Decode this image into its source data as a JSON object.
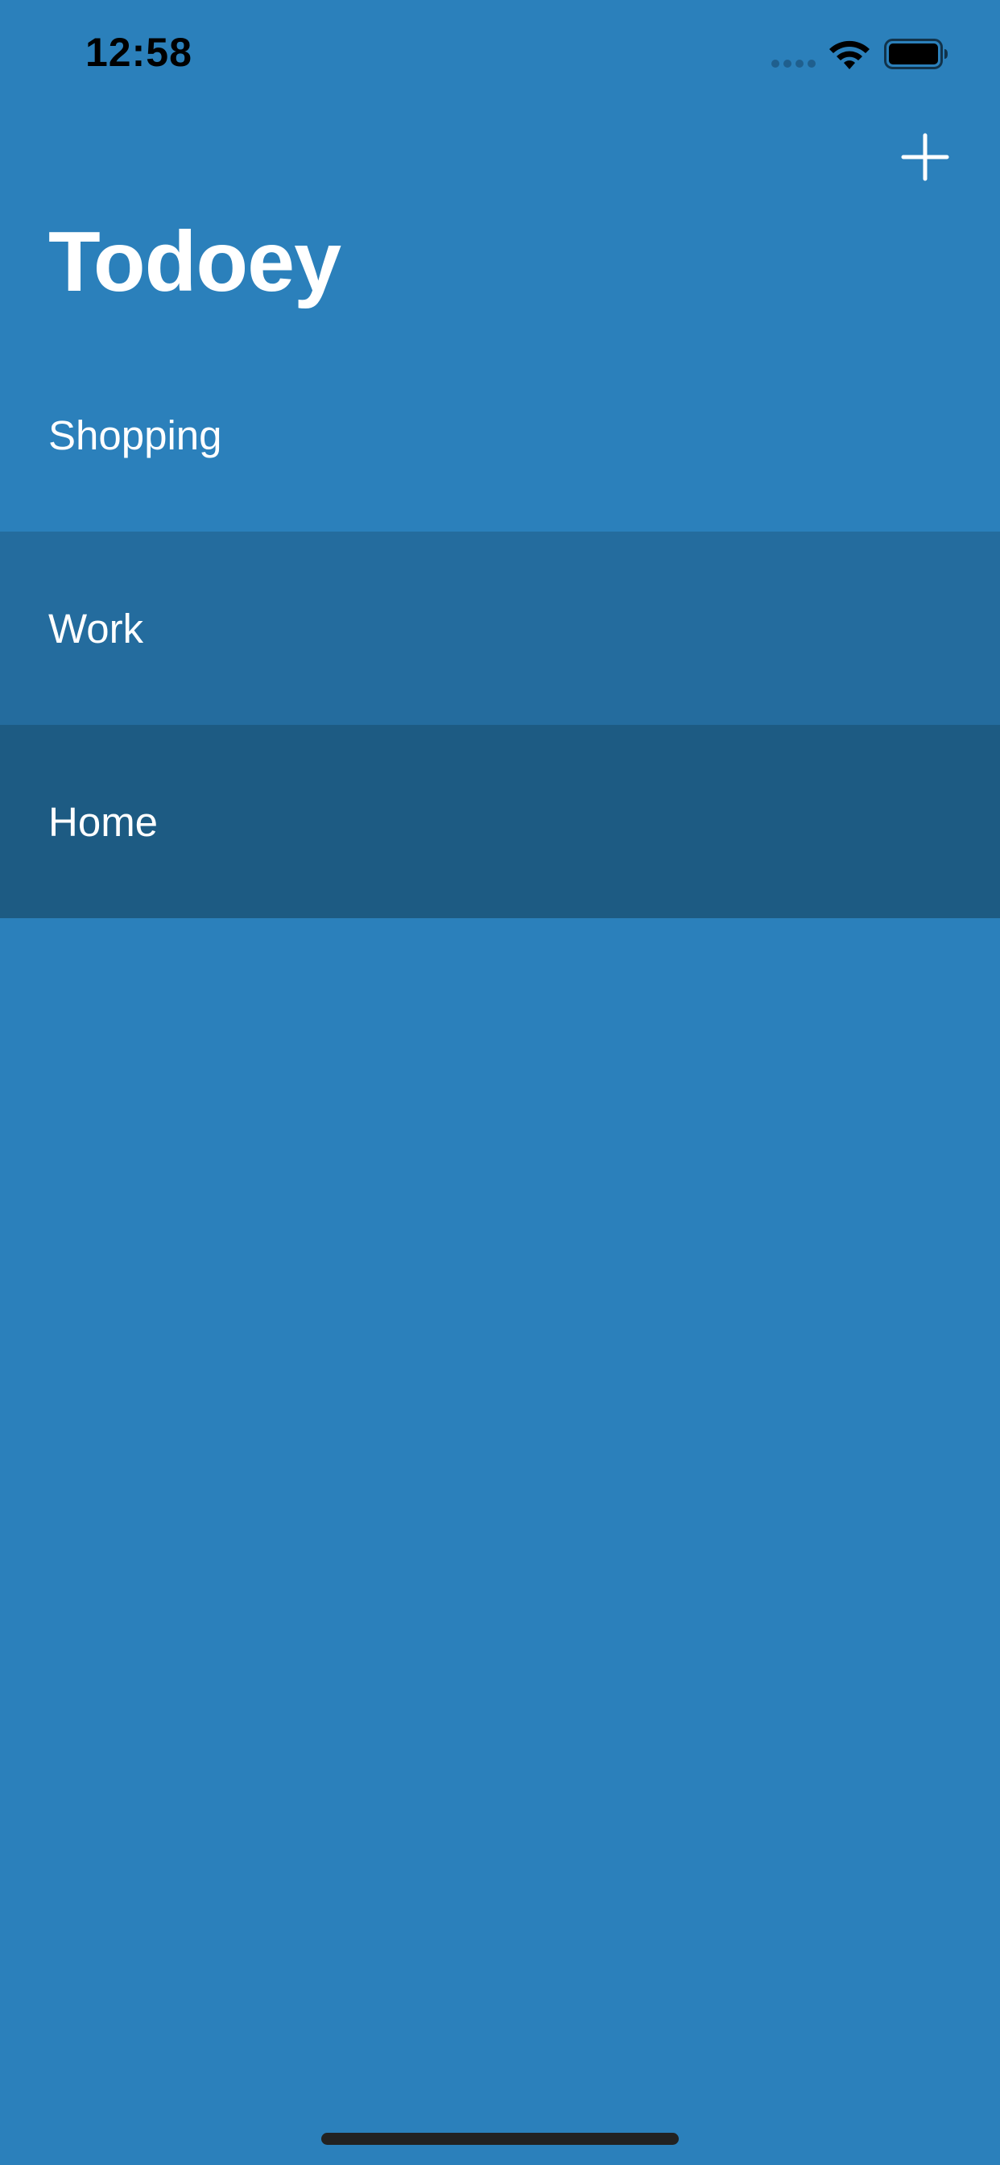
{
  "status_bar": {
    "time": "12:58"
  },
  "nav": {
    "title": "Todoey",
    "add_icon": "plus-icon"
  },
  "categories": [
    {
      "label": "Shopping",
      "color": "#2b80bb"
    },
    {
      "label": "Work",
      "color": "#246c9e"
    },
    {
      "label": "Home",
      "color": "#1d5b83"
    }
  ],
  "colors": {
    "background": "#2b80bb",
    "text": "#ffffff"
  }
}
